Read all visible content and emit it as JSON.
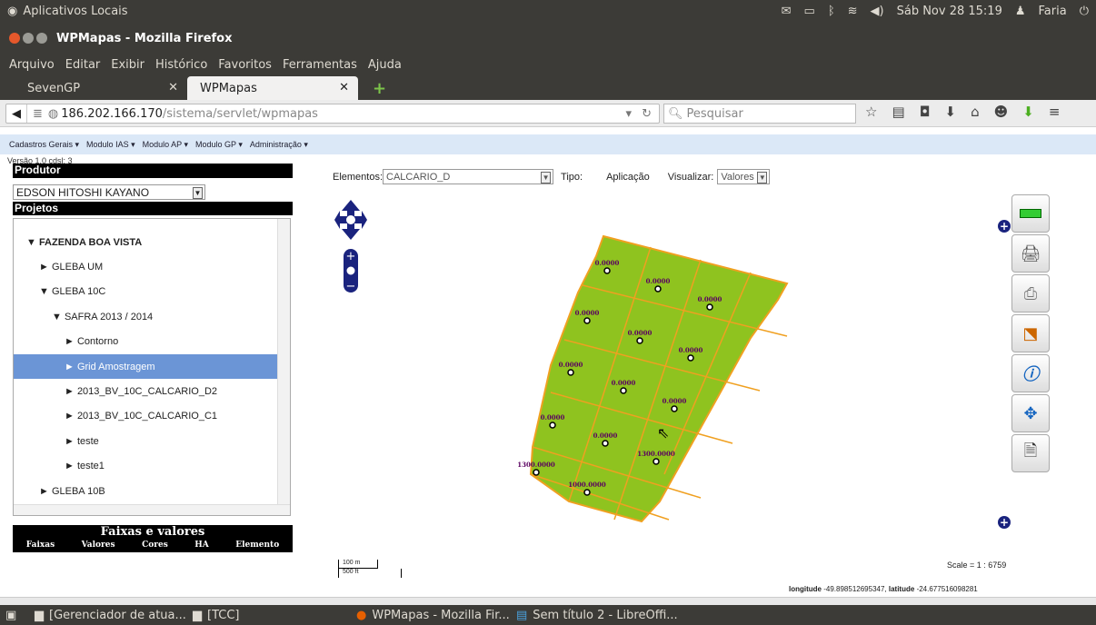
{
  "system": {
    "app_title": "Aplicativos Locais",
    "clock": "Sáb Nov 28 15:19",
    "user": "Faria"
  },
  "window": {
    "title": "WPMapas - Mozilla Firefox"
  },
  "menu": [
    "Arquivo",
    "Editar",
    "Exibir",
    "Histórico",
    "Favoritos",
    "Ferramentas",
    "Ajuda"
  ],
  "tabs": [
    {
      "label": "SevenGP",
      "active": false
    },
    {
      "label": "WPMapas",
      "active": true
    }
  ],
  "nav": {
    "url_host": "186.202.166.170",
    "url_path": "/sistema/servlet/wpmapas",
    "search_placeholder": "Pesquisar"
  },
  "app_menu": [
    "Cadastros Gerais ▾",
    "Modulo IAS ▾",
    "Modulo AP ▾",
    "Modulo GP ▾",
    "Administração ▾"
  ],
  "left": {
    "version": "Versão 1.0 cdsl: 3",
    "produtor_label": "Produtor",
    "produtor_value": "EDSON HITOSHI KAYANO",
    "projetos_label": "Projetos",
    "tree": [
      {
        "label": "▼ FAZENDA BOA VISTA",
        "indent": 0,
        "bold": true
      },
      {
        "label": "► GLEBA UM",
        "indent": 1
      },
      {
        "label": "▼ GLEBA 10C",
        "indent": 1
      },
      {
        "label": "▼ SAFRA 2013 / 2014",
        "indent": 2
      },
      {
        "label": "► Contorno",
        "indent": 3
      },
      {
        "label": "► Grid Amostragem",
        "indent": 3,
        "selected": true
      },
      {
        "label": "► 2013_BV_10C_CALCARIO_D2",
        "indent": 3
      },
      {
        "label": "► 2013_BV_10C_CALCARIO_C1",
        "indent": 3
      },
      {
        "label": "► teste",
        "indent": 3
      },
      {
        "label": "► teste1",
        "indent": 3
      },
      {
        "label": "► GLEBA 10B",
        "indent": 1
      }
    ],
    "faixas_title": "Faixas e valores",
    "faixas_cols": [
      "Faixas",
      "Valores",
      "Cores",
      "HA",
      "Elemento"
    ]
  },
  "map": {
    "elementos_label": "Elementos:",
    "elementos_value": "CALCARIO_D",
    "tipo_label": "Tipo:",
    "tipo_value": "Aplicação",
    "visualizar_label": "Visualizar:",
    "visualizar_value": "Valores",
    "scale_text": "Scale = 1 : 6759",
    "scalebar_m": "100 m",
    "scalebar_ft": "500 ft",
    "coords_lon_label": "longitude",
    "coords_lon": "-49.898512695347",
    "coords_lat_label": "latitude",
    "coords_lat": "-24.677516098281",
    "sample_values": [
      "0.0000",
      "0.0000",
      "0.0000",
      "0.0000",
      "0.0000",
      "0.0000",
      "0.0000",
      "0.0000",
      "0.0000",
      "0.0000",
      "0.0000",
      "1300.0000",
      "1300.0000",
      "1000.0000"
    ],
    "field_color": "#8fc31f",
    "grid_color": "#f0a020"
  },
  "taskbar": [
    {
      "label": "[Gerenciador de atua..."
    },
    {
      "label": "[TCC]"
    },
    {
      "label": "WPMapas - Mozilla Fir..."
    },
    {
      "label": "Sem título 2 - LibreOffi..."
    }
  ]
}
